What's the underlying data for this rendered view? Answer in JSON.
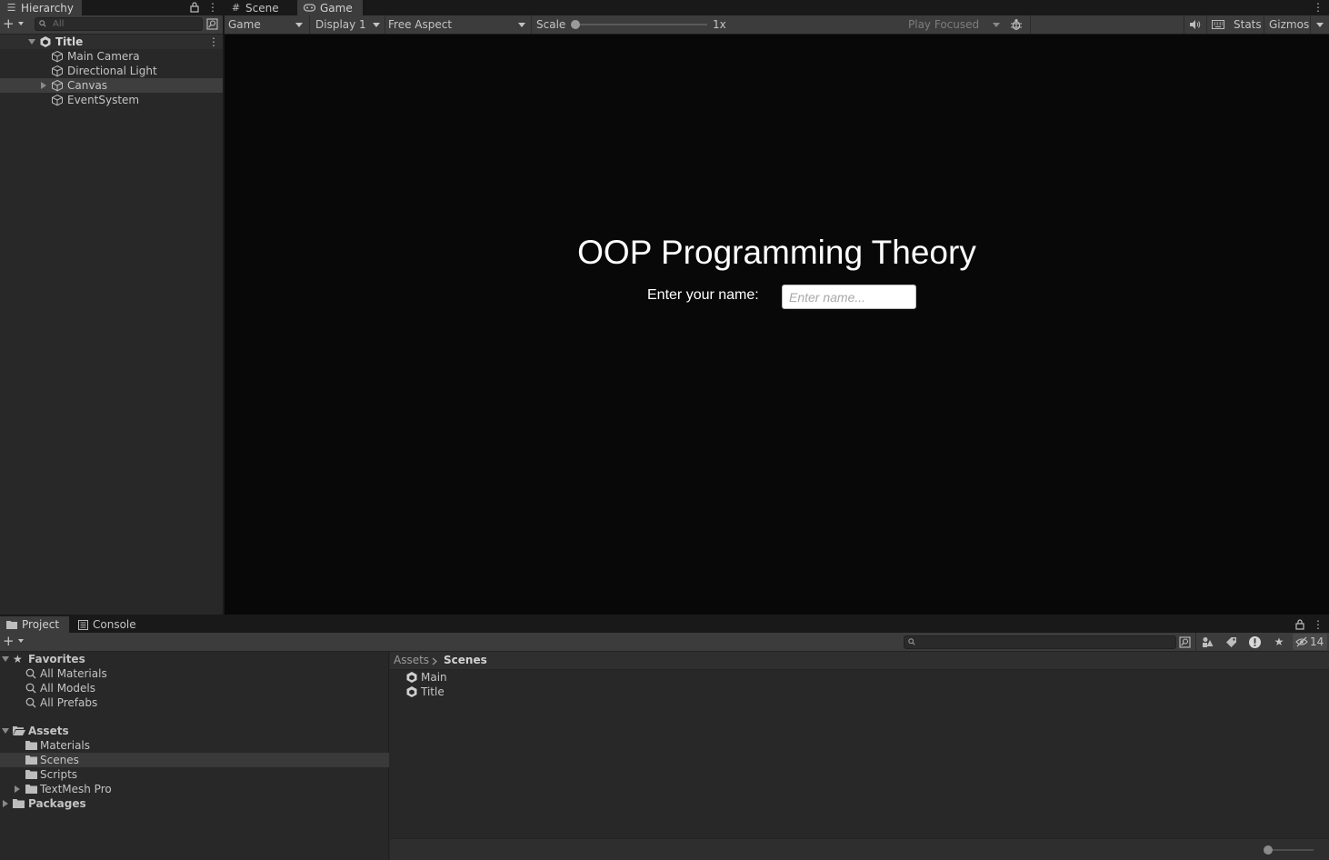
{
  "hierarchy": {
    "tab_label": "Hierarchy",
    "search_placeholder": "All",
    "scene_name": "Title",
    "items": [
      {
        "label": "Main Camera"
      },
      {
        "label": "Directional Light"
      },
      {
        "label": "Canvas"
      },
      {
        "label": "EventSystem"
      }
    ]
  },
  "view_tabs": {
    "scene_label": "Scene",
    "game_label": "Game"
  },
  "game_toolbar": {
    "mode": "Game",
    "display": "Display 1",
    "aspect": "Free Aspect",
    "scale_label": "Scale",
    "scale_value": "1x",
    "play_mode": "Play Focused",
    "stats_label": "Stats",
    "gizmos_label": "Gizmos"
  },
  "game": {
    "title": "OOP Programming Theory",
    "name_label": "Enter your name:",
    "name_placeholder": "Enter name..."
  },
  "project": {
    "tab_project": "Project",
    "tab_console": "Console",
    "hidden_count": "14",
    "favorites_label": "Favorites",
    "favorites": [
      {
        "label": "All Materials"
      },
      {
        "label": "All Models"
      },
      {
        "label": "All Prefabs"
      }
    ],
    "assets_label": "Assets",
    "asset_folders": [
      {
        "label": "Materials"
      },
      {
        "label": "Scenes"
      },
      {
        "label": "Scripts"
      },
      {
        "label": "TextMesh Pro"
      }
    ],
    "packages_label": "Packages",
    "breadcrumb": {
      "root": "Assets",
      "current": "Scenes"
    },
    "files": [
      {
        "label": "Main"
      },
      {
        "label": "Title"
      }
    ]
  },
  "colors": {
    "editor_bg": "#282828",
    "toolbar_bg": "#3c3c3c",
    "game_bg": "#080808",
    "selection": "#3e3e3e"
  }
}
